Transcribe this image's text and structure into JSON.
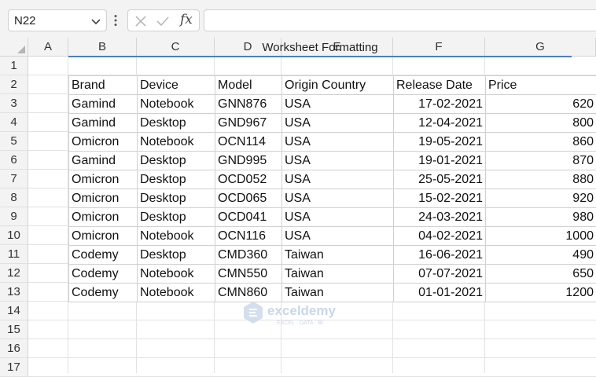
{
  "name_box": {
    "value": "N22"
  },
  "formula_bar": {
    "value": "",
    "fx_label": "fx"
  },
  "columns": [
    "A",
    "B",
    "C",
    "D",
    "E",
    "F",
    "G"
  ],
  "rows": [
    "1",
    "2",
    "3",
    "4",
    "5",
    "6",
    "7",
    "8",
    "9",
    "10",
    "11",
    "12",
    "13",
    "14",
    "15",
    "16",
    "17"
  ],
  "sheet": {
    "title": "Worksheet Formatting",
    "headers": [
      "Brand",
      "Device",
      "Model",
      "Origin Country",
      "Release Date",
      "Price"
    ],
    "records": [
      [
        "Gamind",
        "Notebook",
        "GNN876",
        "USA",
        "17-02-2021",
        "620"
      ],
      [
        "Gamind",
        "Desktop",
        "GND967",
        "USA",
        "12-04-2021",
        "800"
      ],
      [
        "Omicron",
        "Notebook",
        "OCN114",
        "USA",
        "19-05-2021",
        "860"
      ],
      [
        "Gamind",
        "Desktop",
        "GND995",
        "USA",
        "19-01-2021",
        "870"
      ],
      [
        "Omicron",
        "Desktop",
        "OCD052",
        "USA",
        "25-05-2021",
        "880"
      ],
      [
        "Omicron",
        "Desktop",
        "OCD065",
        "USA",
        "15-02-2021",
        "920"
      ],
      [
        "Omicron",
        "Desktop",
        "OCD041",
        "USA",
        "24-03-2021",
        "980"
      ],
      [
        "Omicron",
        "Notebook",
        "OCN116",
        "USA",
        "04-02-2021",
        "1000"
      ],
      [
        "Codemy",
        "Desktop",
        "CMD360",
        "Taiwan",
        "16-06-2021",
        "490"
      ],
      [
        "Codemy",
        "Notebook",
        "CMN550",
        "Taiwan",
        "07-07-2021",
        "650"
      ],
      [
        "Codemy",
        "Notebook",
        "CMN860",
        "Taiwan",
        "01-01-2021",
        "1200"
      ]
    ]
  },
  "watermark": {
    "name": "exceldemy",
    "tagline": "EXCEL · DATA · BI"
  },
  "colors": {
    "title_rule": "#4a7fc1",
    "header_bg": "#f3f3f3",
    "gridline": "#e2e2e2"
  }
}
